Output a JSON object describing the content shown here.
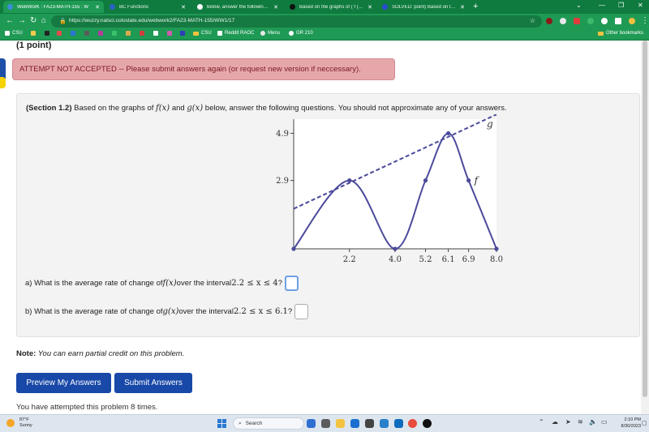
{
  "browser": {
    "tabs": [
      {
        "title": "WeBWorK : FA23-MATH-155 : W",
        "active": true,
        "favicon_color": "#3c8dd9"
      },
      {
        "title": "BC Functions",
        "active": false,
        "favicon_color": "#2b62c4"
      },
      {
        "title": "below, answer the following que",
        "active": false,
        "favicon_color": "#ffffff"
      },
      {
        "title": "Based on the graphs of ( f ( x ) a",
        "active": false,
        "favicon_color": "#111111"
      },
      {
        "title": "SOLVED: point) Based on the gra",
        "active": false,
        "favicon_color": "#2a4bd1"
      }
    ],
    "new_tab": "+",
    "url": "https://wuzzy.natsci.colostate.edu/webwork2/FA23-MATH-155/WW1/17",
    "bookmarks": [
      "CSU",
      "CSU",
      "Reddit RAOC",
      "Menu",
      "GR 210"
    ],
    "other_bookmarks": "Other bookmarks"
  },
  "page": {
    "points": "(1 point)",
    "alert": "ATTEMPT NOT ACCEPTED -- Please submit answers again (or request new version if neccessary).",
    "question": {
      "section": "(Section 1.2)",
      "text_1": " Based on the graphs of ",
      "f": "f(x)",
      "text_2": " and ",
      "g": "g(x)",
      "text_3": " below, answer the following questions. You should not approximate any of your answers."
    },
    "qa": {
      "prefix": "a) What is the average rate of change of ",
      "func": "f(x)",
      "mid": " over the interval ",
      "interval": "2.2 ≤ x ≤ 4",
      "q": " ?"
    },
    "qb": {
      "prefix": "b) What is the average rate of change of ",
      "func": "g(x)",
      "mid": " over the interval ",
      "interval": "2.2 ≤ x ≤ 6.1",
      "q": " ?"
    },
    "note_label": "Note:",
    "note_text": " You can earn partial credit on this problem.",
    "preview_button": "Preview My Answers",
    "submit_button": "Submit Answers",
    "attempts": "You have attempted this problem 8 times."
  },
  "chart_data": {
    "type": "line",
    "x_ticks": [
      "2.2",
      "4.0",
      "5.2",
      "6.1",
      "6.9",
      "8.0"
    ],
    "y_ticks": [
      "4.9",
      "2.9"
    ],
    "xlim": [
      0,
      8.0
    ],
    "ylim": [
      0,
      5.5
    ],
    "series": [
      {
        "name": "f",
        "style": "solid",
        "points": [
          [
            0,
            0
          ],
          [
            2.2,
            2.9
          ],
          [
            4.0,
            0
          ],
          [
            5.2,
            2.9
          ],
          [
            6.1,
            4.9
          ],
          [
            6.9,
            2.9
          ],
          [
            8.0,
            0
          ]
        ]
      },
      {
        "name": "g",
        "style": "dashed",
        "points": [
          [
            0,
            1.7
          ],
          [
            8.0,
            5.7
          ]
        ]
      }
    ],
    "marked_points": [
      [
        0,
        0
      ],
      [
        2.2,
        2.9
      ],
      [
        4.0,
        0
      ],
      [
        5.2,
        2.9
      ],
      [
        6.1,
        4.9
      ],
      [
        6.9,
        2.9
      ],
      [
        8.0,
        0
      ]
    ],
    "line_color": "#4b4a9b"
  },
  "taskbar": {
    "temperature": "87°F",
    "condition": "Sunny",
    "search": "Search",
    "time": "2:10 PM",
    "date": "8/30/2023"
  }
}
